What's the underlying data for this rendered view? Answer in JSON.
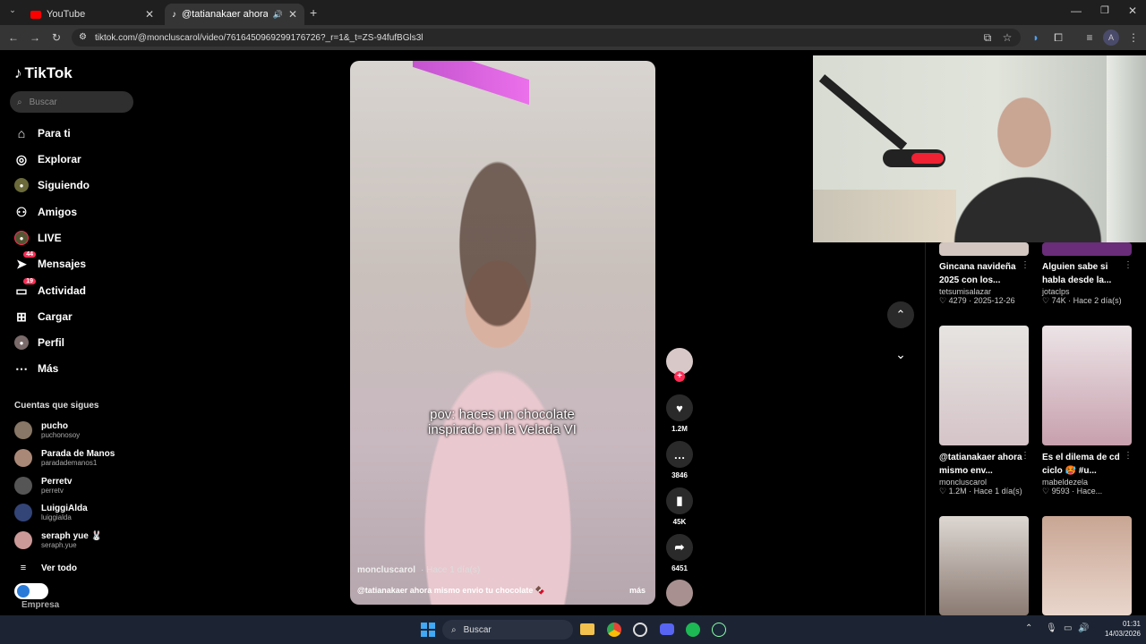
{
  "browser": {
    "tabs": [
      {
        "label": "YouTube"
      },
      {
        "label": "@tatianakaer ahora mismo"
      }
    ],
    "url": "tiktok.com/@moncluscarol/video/7616450969299176726?_r=1&_t=ZS-94fufBGls3l",
    "profile_initial": "A"
  },
  "sidebar": {
    "logo": "TikTok",
    "search_placeholder": "Buscar",
    "nav": [
      {
        "label": "Para ti",
        "icon": "home-icon"
      },
      {
        "label": "Explorar",
        "icon": "compass-icon"
      },
      {
        "label": "Siguiendo",
        "icon": "following-icon"
      },
      {
        "label": "Amigos",
        "icon": "friends-icon"
      },
      {
        "label": "LIVE",
        "icon": "live-icon"
      },
      {
        "label": "Mensajes",
        "icon": "messages-icon",
        "badge": "44"
      },
      {
        "label": "Actividad",
        "icon": "activity-icon",
        "badge": "19"
      },
      {
        "label": "Cargar",
        "icon": "upload-icon"
      },
      {
        "label": "Perfil",
        "icon": "profile-icon"
      },
      {
        "label": "Más",
        "icon": "more-icon"
      }
    ],
    "following_title": "Cuentas que sigues",
    "following": [
      {
        "name": "pucho",
        "handle": "puchonosoy"
      },
      {
        "name": "Parada de Manos",
        "handle": "paradademanos1"
      },
      {
        "name": "Perretv",
        "handle": "perretv"
      },
      {
        "name": "LuiggiAlda",
        "handle": "luiggialda"
      },
      {
        "name": "seraph yue 🐰",
        "handle": "seraph.yue"
      }
    ],
    "see_all": "Ver todo",
    "company": "Empresa"
  },
  "video": {
    "caption_overlay": "pov: haces un chocolate inspirado en la Velada VI",
    "author": "moncluscarol",
    "time": "· Hace 1 día(s)",
    "description": "@tatianakaer ahora mismo envio tu chocolate 🍫",
    "more": "más",
    "actions": {
      "likes": "1.2M",
      "comments": "3846",
      "saves": "45K",
      "shares": "6451"
    }
  },
  "related": [
    {
      "title": "Gincana navideña 2025 con los...",
      "author": "tetsumisalazar",
      "likes": "4279",
      "date": "2025-12-26"
    },
    {
      "title": "Alguien sabe si habla desde la...",
      "author": "jotaclps",
      "likes": "74K",
      "date": "Hace 2 día(s)"
    },
    {
      "title": "@tatianakaer ahora mismo env...",
      "author": "moncluscarol",
      "likes": "1.2M",
      "date": "Hace 1 día(s)"
    },
    {
      "title": "Es el dilema de cd ciclo 🥵 #u...",
      "author": "mabeldezela",
      "likes": "9593",
      "date": "Hace..."
    }
  ],
  "taskbar": {
    "search": "Buscar",
    "time": "01:31",
    "date": "14/03/2026"
  },
  "colors": {
    "accent": "#fe2c55",
    "bg": "#000000"
  }
}
